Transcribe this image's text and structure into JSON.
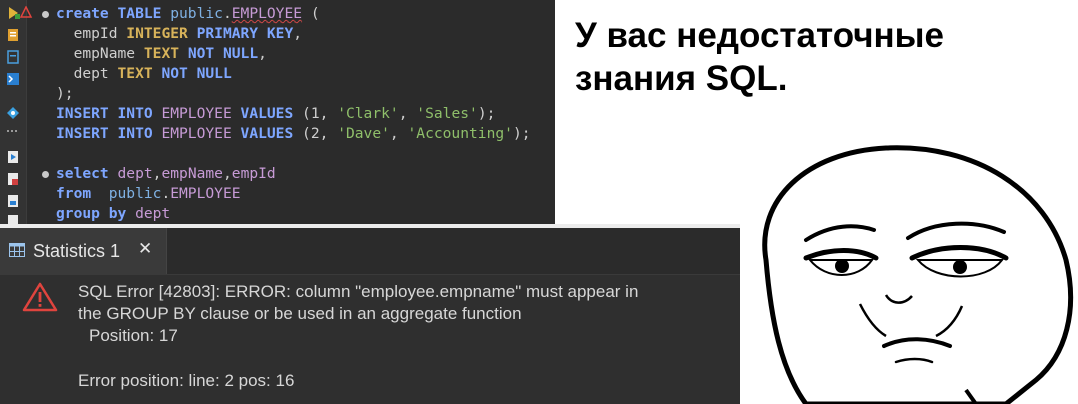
{
  "editor": {
    "lines": [
      [
        {
          "t": "create ",
          "c": "kw"
        },
        {
          "t": "TABLE ",
          "c": "kw"
        },
        {
          "t": "public",
          "c": "tb"
        },
        {
          "t": ".",
          "c": "plain"
        },
        {
          "t": "EMPLOYEE",
          "c": "id"
        },
        {
          "t": " (",
          "c": "plain"
        }
      ],
      [
        {
          "t": "  empId ",
          "c": "plain"
        },
        {
          "t": "INTEGER ",
          "c": "kwb"
        },
        {
          "t": "PRIMARY KEY",
          "c": "kw"
        },
        {
          "t": ",",
          "c": "plain"
        }
      ],
      [
        {
          "t": "  empName ",
          "c": "plain"
        },
        {
          "t": "TEXT ",
          "c": "kwb"
        },
        {
          "t": "NOT NULL",
          "c": "kw"
        },
        {
          "t": ",",
          "c": "plain"
        }
      ],
      [
        {
          "t": "  dept ",
          "c": "plain"
        },
        {
          "t": "TEXT ",
          "c": "kwb"
        },
        {
          "t": "NOT NULL",
          "c": "kw"
        }
      ],
      [
        {
          "t": ");",
          "c": "plain"
        }
      ],
      [
        {
          "t": "INSERT ",
          "c": "kw"
        },
        {
          "t": "INTO ",
          "c": "kw"
        },
        {
          "t": "EMPLOYEE ",
          "c": "id"
        },
        {
          "t": "VALUES ",
          "c": "kw"
        },
        {
          "t": "(1, ",
          "c": "plain"
        },
        {
          "t": "'Clark'",
          "c": "str"
        },
        {
          "t": ", ",
          "c": "plain"
        },
        {
          "t": "'Sales'",
          "c": "str"
        },
        {
          "t": ");",
          "c": "plain"
        }
      ],
      [
        {
          "t": "INSERT ",
          "c": "kw"
        },
        {
          "t": "INTO ",
          "c": "kw"
        },
        {
          "t": "EMPLOYEE ",
          "c": "id"
        },
        {
          "t": "VALUES ",
          "c": "kw"
        },
        {
          "t": "(2, ",
          "c": "plain"
        },
        {
          "t": "'Dave'",
          "c": "str"
        },
        {
          "t": ", ",
          "c": "plain"
        },
        {
          "t": "'Accounting'",
          "c": "str"
        },
        {
          "t": ");",
          "c": "plain"
        }
      ],
      [],
      [
        {
          "t": "select ",
          "c": "kw"
        },
        {
          "t": "dept",
          "c": "id"
        },
        {
          "t": ",",
          "c": "plain"
        },
        {
          "t": "empName",
          "c": "id"
        },
        {
          "t": ",",
          "c": "plain"
        },
        {
          "t": "empId",
          "c": "id"
        }
      ],
      [
        {
          "t": "from  ",
          "c": "kw"
        },
        {
          "t": "public",
          "c": "tb"
        },
        {
          "t": ".",
          "c": "plain"
        },
        {
          "t": "EMPLOYEE",
          "c": "id"
        }
      ],
      [
        {
          "t": "group ",
          "c": "kw"
        },
        {
          "t": "by ",
          "c": "kw"
        },
        {
          "t": "dept",
          "c": "id"
        }
      ]
    ],
    "fold_marker_lines": [
      0,
      8
    ]
  },
  "stats_panel": {
    "tab_label": "Statistics 1",
    "close_glyph": "✕",
    "error_line1": "SQL Error [42803]: ERROR: column \"employee.empname\" must appear in",
    "error_line2": "the GROUP BY clause or be used in an aggregate function",
    "position_line": "Position: 17",
    "error_position": "Error position: line: 2 pos: 16"
  },
  "caption": {
    "line1": "У вас недостаточные",
    "line2": "знания SQL."
  },
  "colors": {
    "editor_bg": "#2b2b2b",
    "keyword": "#7ea6ff",
    "type_keyword": "#d8b35a",
    "identifier": "#c79bd6",
    "string": "#8fbf6a",
    "error_red": "#e0443e"
  },
  "icons": {
    "gutter": [
      "run-icon",
      "warning-icon",
      "script-icon",
      "outline-icon",
      "terminal-icon",
      "explain-icon",
      "more-icon",
      "export-icon",
      "plan-icon",
      "load-icon",
      "save-icon"
    ],
    "tab": "grid-icon",
    "error": "error-triangle-icon"
  }
}
